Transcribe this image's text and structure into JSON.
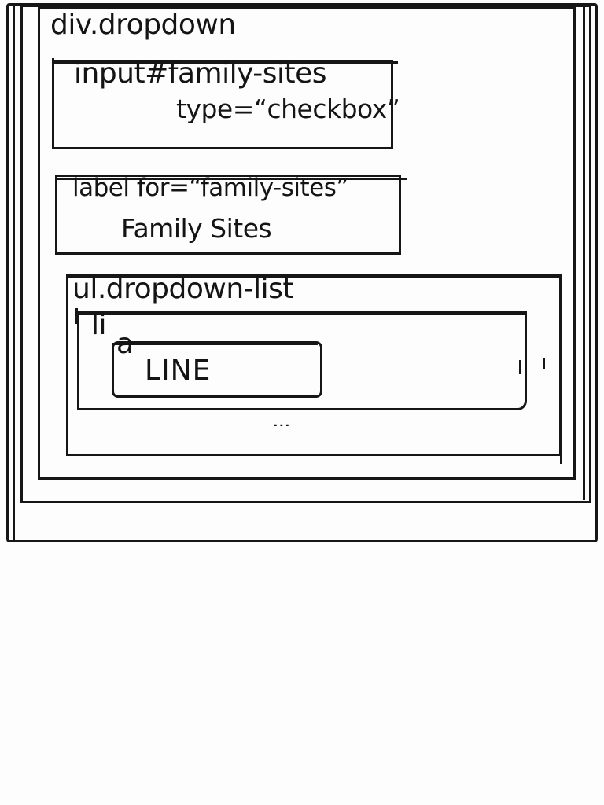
{
  "diagram": {
    "dropdown": {
      "label": "div.dropdown"
    },
    "checkbox_input": {
      "label": "input#family-sites",
      "attribute": "type=“checkbox”"
    },
    "label_element": {
      "label": "label for=“family-sites”",
      "text": "Family Sites"
    },
    "list": {
      "label": "ul.dropdown-list",
      "item": {
        "label": "li",
        "link": {
          "label": "a",
          "text": "LINE"
        }
      },
      "more": "⋮"
    }
  }
}
